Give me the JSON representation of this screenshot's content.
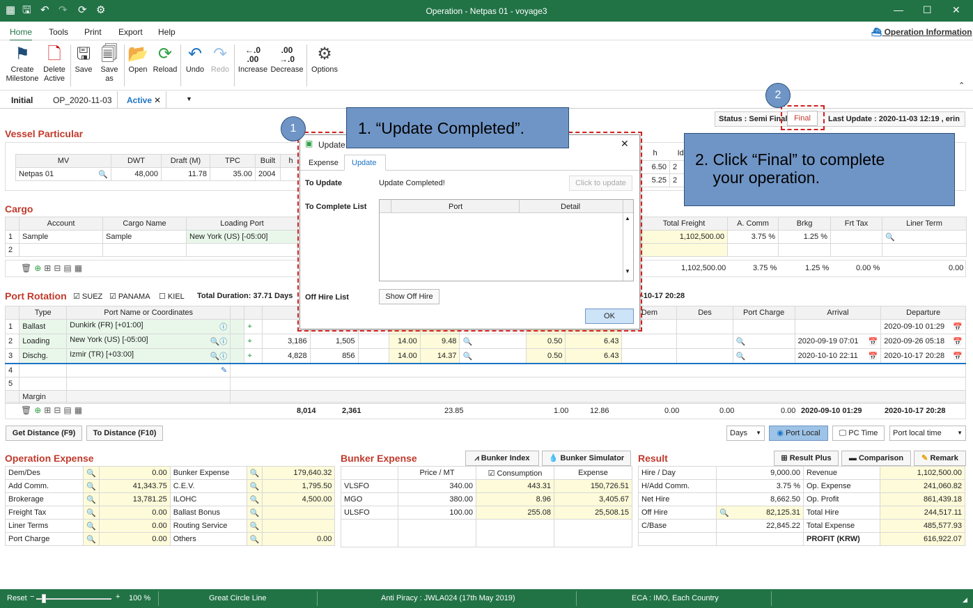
{
  "window": {
    "title": "Operation - Netpas 01 - voyage3"
  },
  "menu": {
    "items": [
      "Home",
      "Tools",
      "Print",
      "Export",
      "Help"
    ],
    "op_info": "Operation Information"
  },
  "ribbon": {
    "create": "Create\nMilestone",
    "delete": "Delete\nActive",
    "save": "Save",
    "save_as": "Save\nas",
    "open": "Open",
    "reload": "Reload",
    "undo": "Undo",
    "redo": "Redo",
    "increase": "Increase",
    "decrease": "Decrease",
    "options": "Options",
    "inc_top": "←.0",
    "inc_bot": ".00",
    "dec_top": ".00",
    "dec_bot": "→.0"
  },
  "tabs": {
    "t1": "Initial",
    "t2": "OP_2020-11-03",
    "t3": "Active"
  },
  "status": {
    "label": "Status : Semi Final",
    "final_btn": "Final",
    "last_update": "Last Update : 2020-11-03 12:19 , erin"
  },
  "vessel": {
    "title": "Vessel Particular",
    "headers": [
      "MV",
      "DWT",
      "Draft (M)",
      "TPC",
      "Built",
      "h",
      "Idle"
    ],
    "row": [
      "Netpas 01",
      "48,000",
      "11.78",
      "35.00",
      "2004",
      "6.50",
      "2"
    ],
    "row2": [
      "5.25",
      "2"
    ]
  },
  "cargo": {
    "title": "Cargo",
    "headers": [
      "Account",
      "Cargo Name",
      "Loading Port"
    ],
    "rows": [
      [
        "1",
        "Sample",
        "Sample",
        "New York (US) [-05:00]"
      ],
      [
        "2",
        "",
        "",
        ""
      ]
    ],
    "right_headers": [
      "Total Freight",
      "A. Comm",
      "Brkg",
      "Frt Tax",
      "Liner Term"
    ],
    "right_row": [
      "1,102,500.00",
      "3.75 %",
      "1.25 %",
      "",
      ""
    ],
    "totals": [
      "1,102,500.00",
      "3.75 %",
      "1.25 %",
      "0.00 %",
      "0.00"
    ]
  },
  "port": {
    "title": "Port Rotation",
    "suez": "SUEZ",
    "panama": "PANAMA",
    "kiel": "KIEL",
    "duration": "Total Duration: 37.71 Days",
    "end_time": "0-10-17 20:28",
    "headers": [
      "Type",
      "Port Name or Coordinates",
      "Dem",
      "Des",
      "Port Charge",
      "Arrival",
      "Departure"
    ],
    "rows": [
      [
        "1",
        "Ballast",
        "Dunkirk (FR) [+01:00]",
        "",
        "",
        "",
        "",
        "",
        "",
        "",
        "",
        "",
        "2020-09-10 01:29"
      ],
      [
        "2",
        "Loading",
        "New York (US) [-05:00]",
        "3,186",
        "1,505",
        "14.00",
        "9.48",
        "0.50",
        "6.43",
        "",
        "2020-09-19 07:01",
        "2020-09-26 05:18"
      ],
      [
        "3",
        "Dischg.",
        "Izmir (TR) [+03:00]",
        "4,828",
        "856",
        "14.00",
        "14.37",
        "0.50",
        "6.43",
        "",
        "2020-10-10 22:11",
        "2020-10-17 20:28"
      ],
      [
        "4"
      ],
      [
        "5"
      ]
    ],
    "margin": "Margin",
    "totals": [
      "8,014",
      "2,361",
      "23.85",
      "1.00",
      "12.86",
      "0.00",
      "0.00",
      "0.00",
      "2020-09-10 01:29",
      "2020-10-17 20:28"
    ]
  },
  "buttons": {
    "get_dist": "Get Distance (F9)",
    "to_dist": "To Distance (F10)",
    "days": "Days",
    "port_local": "Port Local",
    "pc_time": "PC Time",
    "port_local_time": "Port local time"
  },
  "opex": {
    "title": "Operation Expense",
    "rows": [
      [
        "Dem/Des",
        "0.00",
        "Bunker Expense",
        "179,640.32"
      ],
      [
        "Add Comm.",
        "41,343.75",
        "C.E.V.",
        "1,795.50"
      ],
      [
        "Brokerage",
        "13,781.25",
        "ILOHC",
        "4,500.00"
      ],
      [
        "Freight Tax",
        "0.00",
        "Ballast Bonus",
        ""
      ],
      [
        "Liner Terms",
        "0.00",
        "Routing Service",
        ""
      ],
      [
        "Port Charge",
        "0.00",
        "Others",
        "0.00"
      ]
    ]
  },
  "bunker": {
    "title": "Bunker Expense",
    "index_btn": "Bunker Index",
    "sim_btn": "Bunker Simulator",
    "headers": [
      "Price / MT",
      "Consumption",
      "Expense"
    ],
    "rows": [
      [
        "VLSFO",
        "340.00",
        "443.31",
        "150,726.51"
      ],
      [
        "MGO",
        "380.00",
        "8.96",
        "3,405.67"
      ],
      [
        "ULSFO",
        "100.00",
        "255.08",
        "25,508.15"
      ]
    ]
  },
  "result": {
    "title": "Result",
    "plus_btn": "Result Plus",
    "comp_btn": "Comparison",
    "remark_btn": "Remark",
    "rows": [
      [
        "Hire / Day",
        "9,000.00",
        "Revenue",
        "1,102,500.00"
      ],
      [
        "H/Add Comm.",
        "3.75 %",
        "Op. Expense",
        "241,060.82"
      ],
      [
        "Net Hire",
        "8,662.50",
        "Op. Profit",
        "861,439.18"
      ],
      [
        "Off Hire",
        "82,125.31",
        "Total Hire",
        "244,517.11"
      ],
      [
        "C/Base",
        "22,845.22",
        "Total Expense",
        "485,577.93"
      ],
      [
        "",
        "",
        "PROFIT (KRW)",
        "616,922.07"
      ]
    ]
  },
  "dialog": {
    "title": "Update",
    "tab_expense": "Expense",
    "tab_update": "Update",
    "to_update": "To Update",
    "update_msg": "Update Completed!",
    "click_update": "Click to update",
    "to_complete": "To Complete List",
    "col_port": "Port",
    "col_detail": "Detail",
    "off_hire": "Off Hire List",
    "show_off_hire": "Show Off Hire",
    "ok": "OK"
  },
  "callouts": {
    "c1": "1. “Update Completed”.",
    "c2": "2. Click “Final” to complete\n    your operation.",
    "n1": "1",
    "n2": "2"
  },
  "statusbar": {
    "reset": "Reset",
    "zoom": "100 %",
    "gcl": "Great Circle Line",
    "anti": "Anti Piracy : JWLA024 (17th May 2019)",
    "eca": "ECA : IMO, Each Country"
  }
}
